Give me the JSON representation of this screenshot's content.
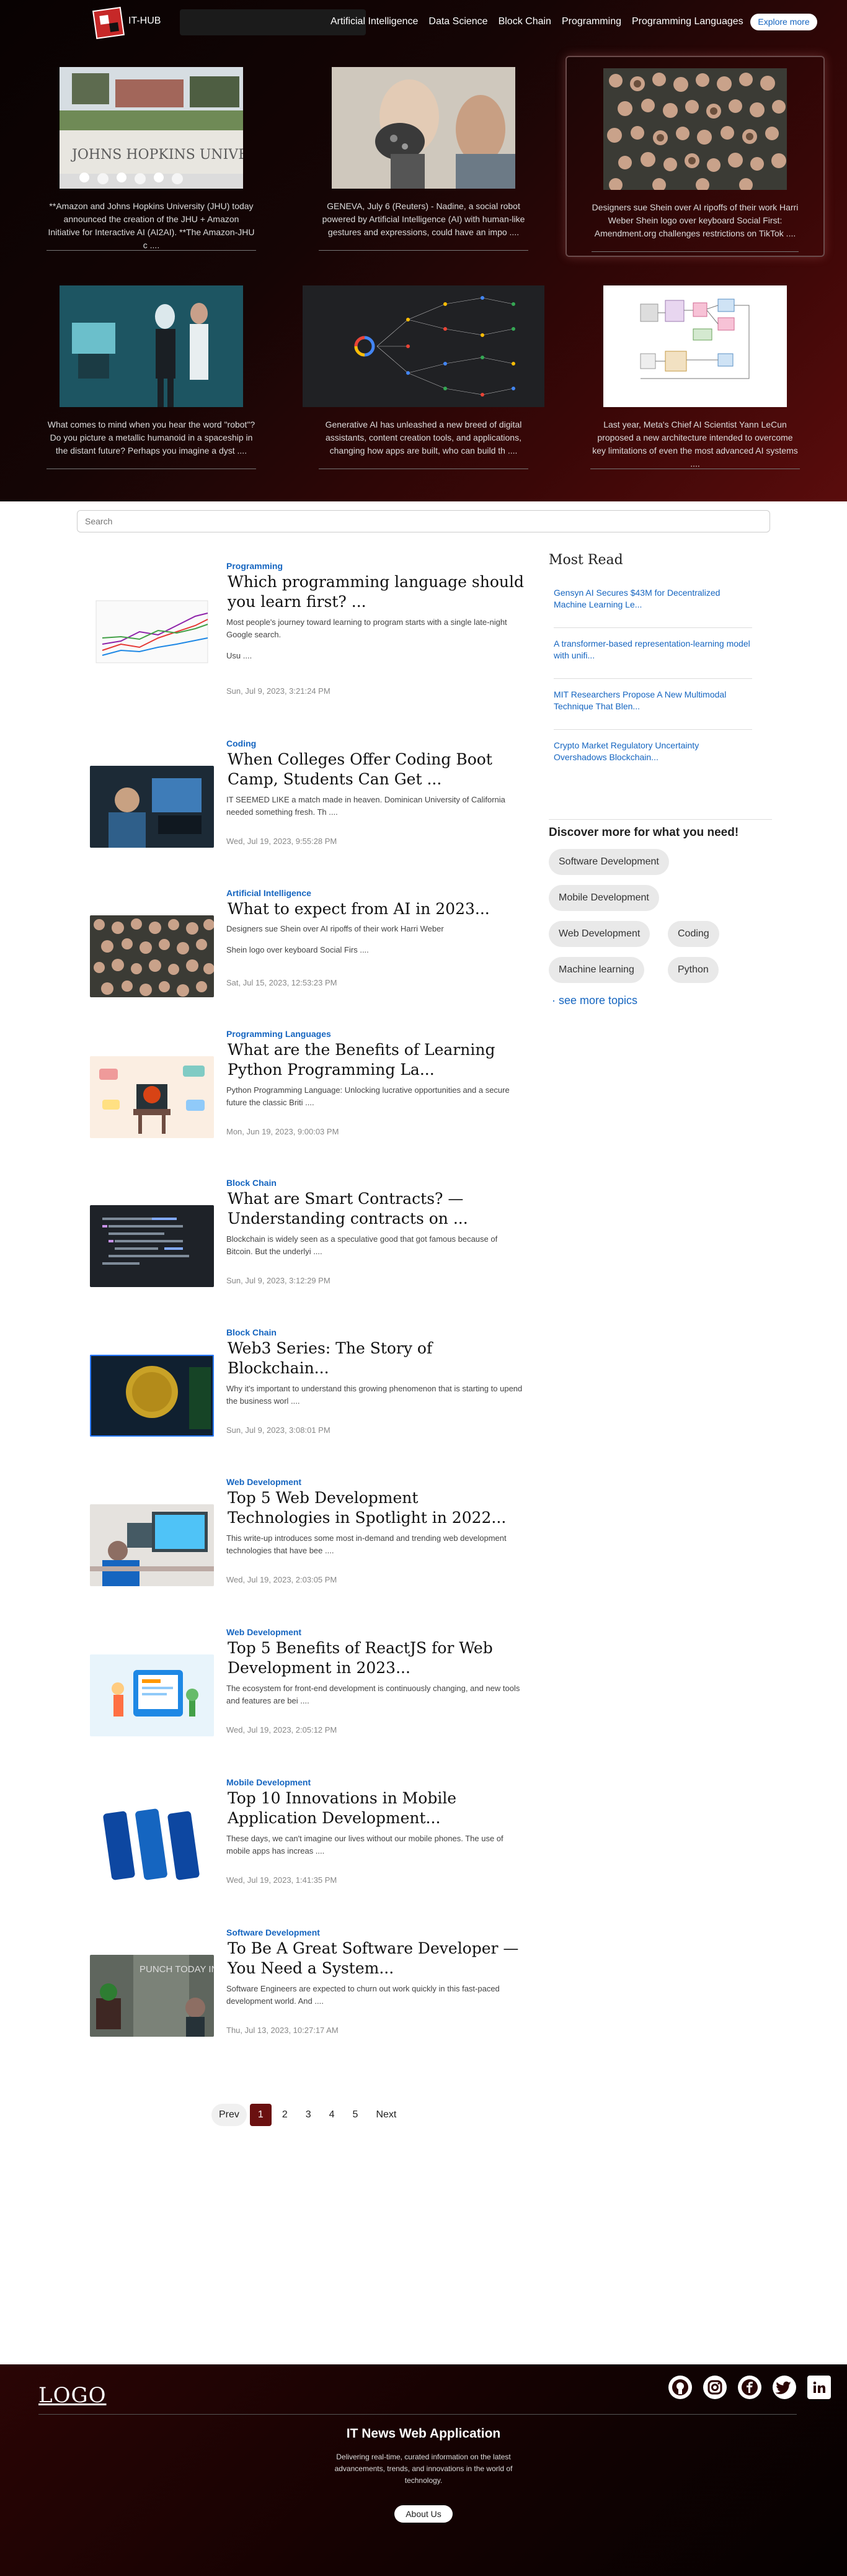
{
  "nav": {
    "brand": "IT-HUB",
    "links": [
      "Artificial Intelligence",
      "Data Science",
      "Block Chain",
      "Programming",
      "Programming Languages"
    ],
    "explore_label": "Explore more"
  },
  "hero_cards": [
    {
      "caption": "**Amazon and Johns Hopkins University (JHU) today announced the creation of the JHU + Amazon Initiative for Interactive AI (AI2AI). **The Amazon-JHU c ...."
    },
    {
      "caption": "GENEVA, July 6 (Reuters) - Nadine, a social robot powered by Artificial Intelligence (AI) with human-like gestures and expressions, could have an impo ...."
    },
    {
      "caption": "Designers sue Shein over AI ripoffs of their work Harri Weber Shein logo over keyboard Social First: Amendment.org challenges restrictions on TikTok ...."
    },
    {
      "caption": "What comes to mind when you hear the word \"robot\"? Do you picture a metallic humanoid in a spaceship in the distant future? Perhaps you imagine a dyst ...."
    },
    {
      "caption": "Generative AI has unleashed a new breed of digital assistants, content creation tools, and applications, changing how apps are built, who can build th ...."
    },
    {
      "caption": "Last year, Meta's Chief AI Scientist Yann LeCun proposed a new architecture intended to overcome key limitations of even the most advanced AI systems ...."
    }
  ],
  "hero_image_text": {
    "jhu_sign": "JOHNS   HOPKINS   UNIVERSITY"
  },
  "search": {
    "placeholder": "Search"
  },
  "articles": [
    {
      "category": "Programming",
      "title": "Which programming language should you learn first? ...",
      "description": "Most people's journey toward learning to program starts with a single late-night Google search.",
      "extra": "Usu ....",
      "date": "Sun, Jul 9, 2023, 3:21:24 PM"
    },
    {
      "category": "Coding",
      "title": "When Colleges Offer Coding Boot Camp, Students Can Get ...",
      "description": "IT SEEMED LIKE a match made in heaven. Dominican University of California needed something fresh. Th ....",
      "extra": "",
      "date": "Wed, Jul 19, 2023, 9:55:28 PM"
    },
    {
      "category": "Artificial Intelligence",
      "title": "What to expect from AI in 2023...",
      "description": "Designers sue Shein over AI ripoffs of their work Harri Weber",
      "extra": "Shein logo over keyboard Social Firs ....",
      "date": "Sat, Jul 15, 2023, 12:53:23 PM"
    },
    {
      "category": "Programming Languages",
      "title": "What are the Benefits of Learning Python Programming La...",
      "description": "Python Programming Language: Unlocking lucrative opportunities and a secure future the classic Briti ....",
      "extra": "",
      "date": "Mon, Jun 19, 2023, 9:00:03 PM"
    },
    {
      "category": "Block Chain",
      "title": "What are Smart Contracts? — Understanding contracts on ...",
      "description": "Blockchain is widely seen as a speculative good that got famous because of Bitcoin. But the underlyi ....",
      "extra": "",
      "date": "Sun, Jul 9, 2023, 3:12:29 PM"
    },
    {
      "category": "Block Chain",
      "title": "Web3 Series: The Story of Blockchain...",
      "description": "Why it's important to understand this growing phenomenon that is starting to upend the business worl ....",
      "extra": "",
      "date": "Sun, Jul 9, 2023, 3:08:01 PM"
    },
    {
      "category": "Web Development",
      "title": "Top 5 Web Development Technologies in Spotlight in 2022...",
      "description": "This write-up introduces some most in-demand and trending web development technologies that have bee ....",
      "extra": "",
      "date": "Wed, Jul 19, 2023, 2:03:05 PM"
    },
    {
      "category": "Web Development",
      "title": "Top 5 Benefits of ReactJS for Web Development in 2023...",
      "description": "The ecosystem for front-end development is continuously changing, and new tools and features are bei ....",
      "extra": "",
      "date": "Wed, Jul 19, 2023, 2:05:12 PM"
    },
    {
      "category": "Mobile Development",
      "title": "Top 10 Innovations in Mobile Application Development...",
      "description": "These days, we can't imagine our lives without our mobile phones. The use of mobile apps has increas ....",
      "extra": "",
      "date": "Wed, Jul 19, 2023, 1:41:35 PM"
    },
    {
      "category": "Software Development",
      "title": "To Be A Great Software Developer — You Need a System...",
      "description": "Software Engineers are expected to churn out work quickly in this fast-paced development world. And ....",
      "extra": "",
      "date": "Thu, Jul 13, 2023, 10:27:17 AM"
    }
  ],
  "thumb_text": {
    "punch": "PUNCH TODAY IN THE FACE"
  },
  "sidebar": {
    "most_read_title": "Most Read",
    "most_read": [
      "Gensyn AI Secures $43M for Decentralized Machine Learning Le...",
      "A transformer-based representation-learning model with unifi...",
      "MIT Researchers Propose A New Multimodal Technique That Blen...",
      "Crypto Market Regulatory Uncertainty Overshadows Blockchain..."
    ],
    "discover_title": "Discover more for what you need!",
    "tags": [
      "Software Development",
      "Mobile Development",
      "Web Development",
      "Coding",
      "Machine learning",
      "Python"
    ],
    "see_more": "see more topics"
  },
  "pager": {
    "prev": "Prev",
    "pages": [
      "1",
      "2",
      "3",
      "4",
      "5"
    ],
    "next": "Next"
  },
  "footer": {
    "logo": "LOGO",
    "title": "IT News Web Application",
    "description": "Delivering real-time, curated information on the latest advancements, trends, and innovations in the world of technology.",
    "about": "About Us"
  },
  "colors": {
    "accent": "#1565c0",
    "hero_dark": "#150505",
    "hero_red": "#5a0c0c",
    "active_page": "#6a1010"
  }
}
